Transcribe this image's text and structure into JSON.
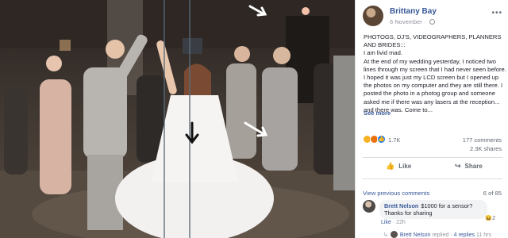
{
  "post": {
    "author": "Brittany Bay",
    "date": "6 November",
    "text_lines": [
      "PHOTOGS, DJ'S, VIDEOGRAPHERS, PLANNERS AND BRIDES:::",
      "I am livid mad.",
      "At the end of my wedding yesterday, I noticed two lines through my screen that I had never seen before. I hoped it was just my LCD screen but I opened up the photos on my computer and they are still there. I posted the photo in a photog group and someone asked me if there was any lasers at the reception... and there was. Come to..."
    ],
    "see_more": "See more",
    "reaction_count": "1.7K",
    "comments": "177 comments",
    "shares": "2.3K shares",
    "like_label": "Like",
    "share_label": "Share"
  },
  "comments_section": {
    "view_previous": "View previous comments",
    "paging": "6 of 85",
    "comment": {
      "name": "Brett Nelson",
      "text": "$1000 for a sensor? Thanks for sharing",
      "reaction_count": "2",
      "like": "Like",
      "time": "22h",
      "reply_author": "Brett Nelson",
      "reply_text": "replied",
      "reply_count": "4 replies",
      "reply_time": "11 hrs"
    }
  },
  "colors": {
    "link": "#385898",
    "laser_line": "#5a6b78",
    "arrow_white": "#ffffff",
    "arrow_black": "#111111"
  },
  "icons": [
    "more-options-icon",
    "globe-icon",
    "haha-reaction-icon",
    "angry-reaction-icon",
    "like-reaction-icon",
    "like-thumb-icon",
    "share-arrow-icon"
  ]
}
